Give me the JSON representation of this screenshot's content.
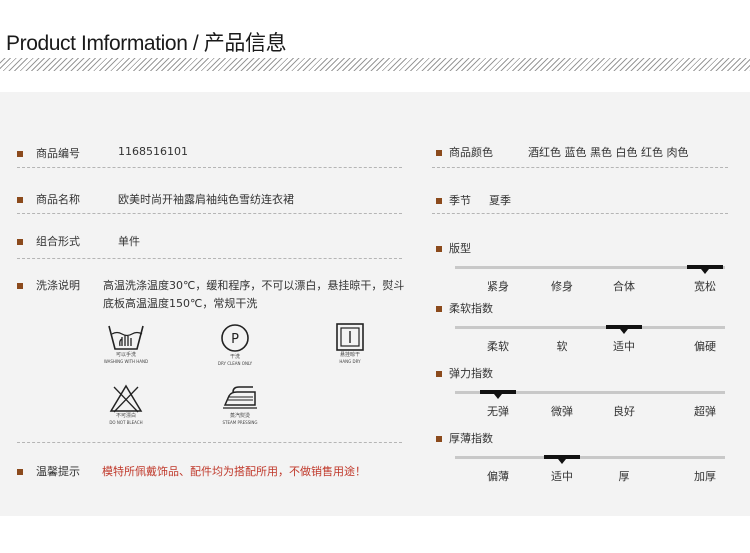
{
  "header": {
    "title": "Product Imformation / 产品信息"
  },
  "left": {
    "sku": {
      "label": "商品编号",
      "value": "1168516101"
    },
    "name": {
      "label": "商品名称",
      "value": "欧美时尚开袖露肩袖纯色雪纺连衣裙"
    },
    "form": {
      "label": "组合形式",
      "value": "单件"
    },
    "wash": {
      "label": "洗涤说明",
      "text": "高温洗涤温度30℃，缓和程序，不可以漂白，悬挂晾干，熨斗底板高温温度150℃，常规干洗",
      "icons": [
        {
          "icon": "hand-wash-icon",
          "cn": "可以手洗",
          "en": "WASHING WITH HAND"
        },
        {
          "icon": "dry-clean-icon",
          "symbol": "P",
          "cn": "干洗",
          "en": "DRY CLEAN ONLY"
        },
        {
          "icon": "hang-dry-icon",
          "cn": "悬挂晾干",
          "en": "HANG DRY"
        },
        {
          "icon": "no-bleach-icon",
          "cn": "不可漂白",
          "en": "DO NOT BLEACH"
        },
        {
          "icon": "steam-iron-icon",
          "cn": "蒸汽熨烫",
          "en": "STEAM PRESSING"
        }
      ]
    },
    "warm": {
      "label": "温馨提示",
      "text": "模特所佩戴饰品、配件均为搭配所用，不做销售用途！"
    }
  },
  "right": {
    "color": {
      "label": "商品颜色",
      "value": "酒红色 蓝色 黑色 白色 红色 肉色"
    },
    "season": {
      "label": "季节",
      "value": "夏季"
    },
    "scales": [
      {
        "label": "版型",
        "options": [
          "紧身",
          "修身",
          "合体",
          "宽松"
        ],
        "selected": 3
      },
      {
        "label": "柔软指数",
        "options": [
          "柔软",
          "软",
          "适中",
          "偏硬"
        ],
        "selected": 2
      },
      {
        "label": "弹力指数",
        "options": [
          "无弹",
          "微弹",
          "良好",
          "超弹"
        ],
        "selected": 0
      },
      {
        "label": "厚薄指数",
        "options": [
          "偏薄",
          "适中",
          "厚",
          "加厚"
        ],
        "selected": 1
      }
    ]
  },
  "colors": {
    "bullet": "#8b4a1c",
    "warning": "#c0392b",
    "panel": "#f3f3f3"
  }
}
